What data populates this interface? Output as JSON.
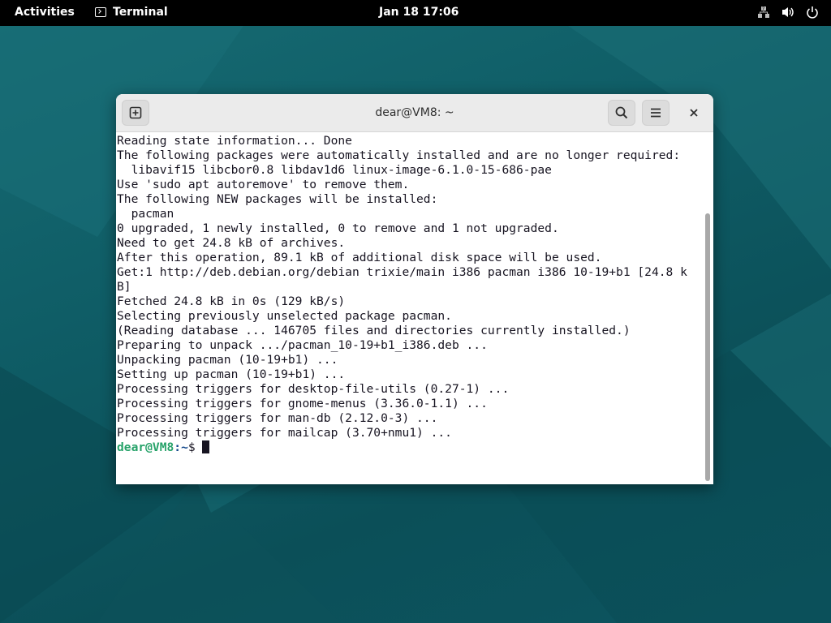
{
  "topbar": {
    "activities": "Activities",
    "app_name": "Terminal",
    "clock": "Jan 18  17:06",
    "tray_icons": [
      "network-icon",
      "volume-icon",
      "power-icon"
    ]
  },
  "window": {
    "title": "dear@VM8: ~",
    "buttons": {
      "new_tab": "new-tab-icon",
      "search": "search-icon",
      "menu": "hamburger-menu-icon",
      "close": "close-icon"
    }
  },
  "terminal": {
    "lines": [
      "Reading state information... Done",
      "The following packages were automatically installed and are no longer required:",
      "  libavif15 libcbor0.8 libdav1d6 linux-image-6.1.0-15-686-pae",
      "Use 'sudo apt autoremove' to remove them.",
      "The following NEW packages will be installed:",
      "  pacman",
      "0 upgraded, 1 newly installed, 0 to remove and 1 not upgraded.",
      "Need to get 24.8 kB of archives.",
      "After this operation, 89.1 kB of additional disk space will be used.",
      "Get:1 http://deb.debian.org/debian trixie/main i386 pacman i386 10-19+b1 [24.8 k",
      "B]",
      "Fetched 24.8 kB in 0s (129 kB/s)",
      "Selecting previously unselected package pacman.",
      "(Reading database ... 146705 files and directories currently installed.)",
      "Preparing to unpack .../pacman_10-19+b1_i386.deb ...",
      "Unpacking pacman (10-19+b1) ...",
      "Setting up pacman (10-19+b1) ...",
      "Processing triggers for desktop-file-utils (0.27-1) ...",
      "Processing triggers for gnome-menus (3.36.0-1.1) ...",
      "Processing triggers for man-db (2.12.0-3) ...",
      "Processing triggers for mailcap (3.70+nmu1) ..."
    ],
    "prompt_user": "dear@VM8",
    "prompt_path": ":~",
    "prompt_symbol": "$ "
  },
  "colors": {
    "prompt_user": "#26a269",
    "desktop": "#0f5a63"
  }
}
